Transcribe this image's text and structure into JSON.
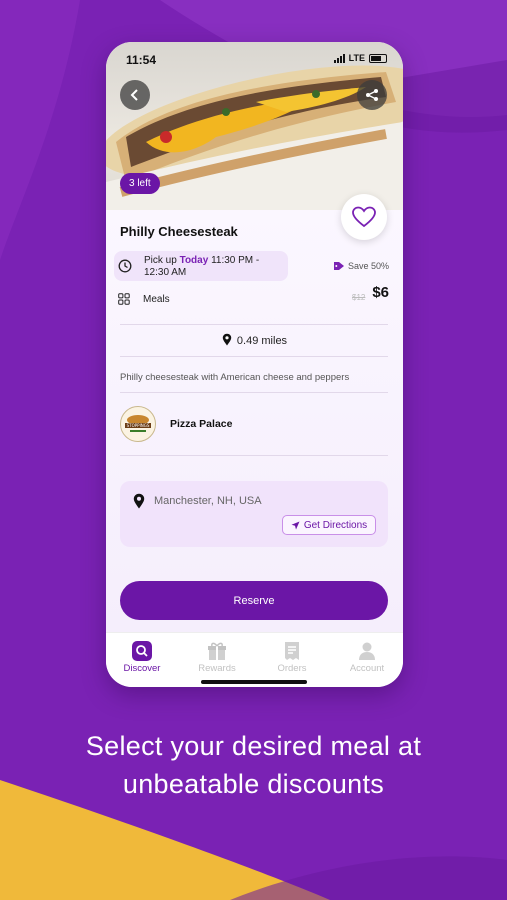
{
  "status_bar": {
    "time": "11:54",
    "network": "LTE"
  },
  "product": {
    "title": "Philly Cheesesteak",
    "remaining_badge": "3 left",
    "pickup_prefix": "Pick up",
    "pickup_day": "Today",
    "pickup_time": "11:30 PM - 12:30 AM",
    "category": "Meals",
    "save_label": "Save 50%",
    "old_price": "$12",
    "price": "$6",
    "distance": "0.49 miles",
    "description": "Philly cheesesteak with American cheese and peppers"
  },
  "store": {
    "name": "Pizza Palace",
    "logo_text": "STOPPINGS"
  },
  "location": {
    "address": "Manchester, NH, USA",
    "directions_label": "Get Directions"
  },
  "actions": {
    "reserve_label": "Reserve"
  },
  "tabs": [
    {
      "label": "Discover",
      "icon": "search-icon",
      "active": true
    },
    {
      "label": "Rewards",
      "icon": "gift-icon",
      "active": false
    },
    {
      "label": "Orders",
      "icon": "receipt-icon",
      "active": false
    },
    {
      "label": "Account",
      "icon": "user-icon",
      "active": false
    }
  ],
  "caption": {
    "line1": "Select your desired meal at",
    "line2": "unbeatable discounts"
  },
  "colors": {
    "primary": "#6b16a6",
    "background": "#7a22b4",
    "accent_yellow": "#f0b93a"
  }
}
